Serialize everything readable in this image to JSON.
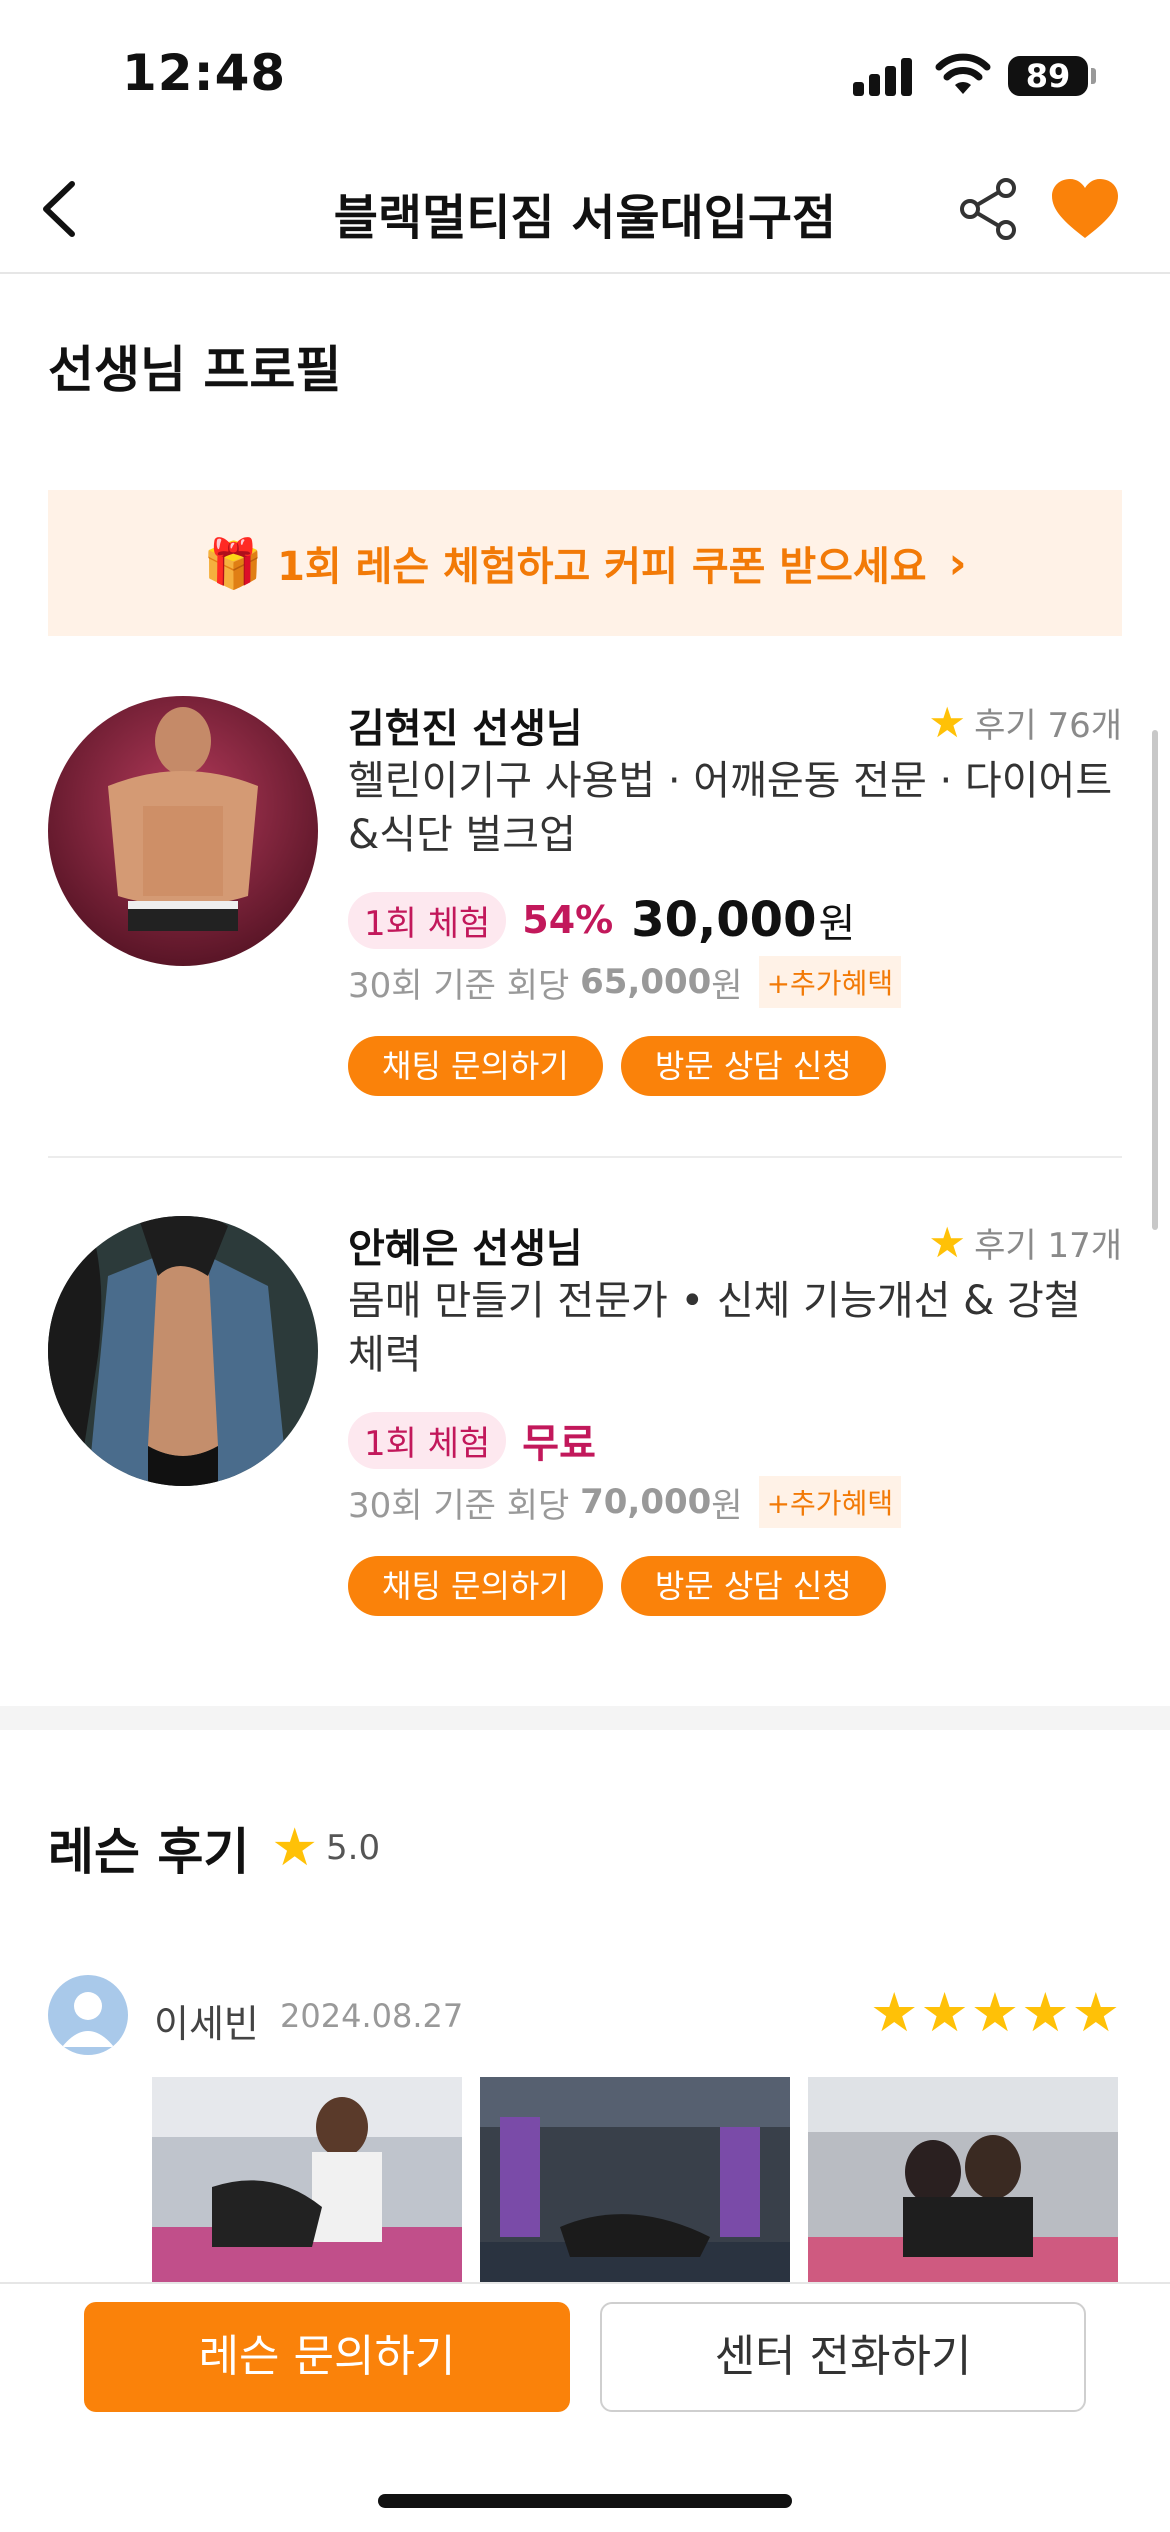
{
  "status": {
    "time": "12:48",
    "battery": "89"
  },
  "nav": {
    "title": "블랙멀티짐 서울대입구점"
  },
  "profile_section": {
    "title": "선생님 프로필"
  },
  "promo": {
    "text": "1회 레슨 체험하고 커피 쿠폰 받으세요",
    "chevron": "›"
  },
  "trainers": [
    {
      "name": "김현진 선생님",
      "rating_star": "★",
      "review_count": "후기 76개",
      "desc": "헬린이기구 사용법 · 어깨운동 전문 · 다이어트 &식단 벌크업",
      "trial_tag": "1회 체험",
      "discount": "54%",
      "price": "30,000",
      "price_unit": "원",
      "base_prefix": "30회 기준 회당",
      "base_price": "65,000",
      "base_unit": "원",
      "extra": "+추가혜택",
      "chat_button": "채팅 문의하기",
      "visit_button": "방문 상담 신청"
    },
    {
      "name": "안혜은 선생님",
      "rating_star": "★",
      "review_count": "후기 17개",
      "desc": "몸매 만들기 전문가 • 신체 기능개선 & 강철 체력",
      "trial_tag": "1회 체험",
      "free": "무료",
      "base_prefix": "30회 기준 회당",
      "base_price": "70,000",
      "base_unit": "원",
      "extra": "+추가혜택",
      "chat_button": "채팅 문의하기",
      "visit_button": "방문 상담 신청"
    }
  ],
  "reviews": {
    "title": "레슨 후기",
    "star": "★",
    "score": "5.0",
    "items": [
      {
        "name": "이세빈",
        "date": "2024.08.27",
        "stars": "★★★★★"
      }
    ]
  },
  "bottom": {
    "primary": "레슨 문의하기",
    "secondary": "센터 전화하기"
  },
  "colors": {
    "accent": "#fa820a",
    "pink": "#c2185b",
    "star": "#ffc107"
  }
}
